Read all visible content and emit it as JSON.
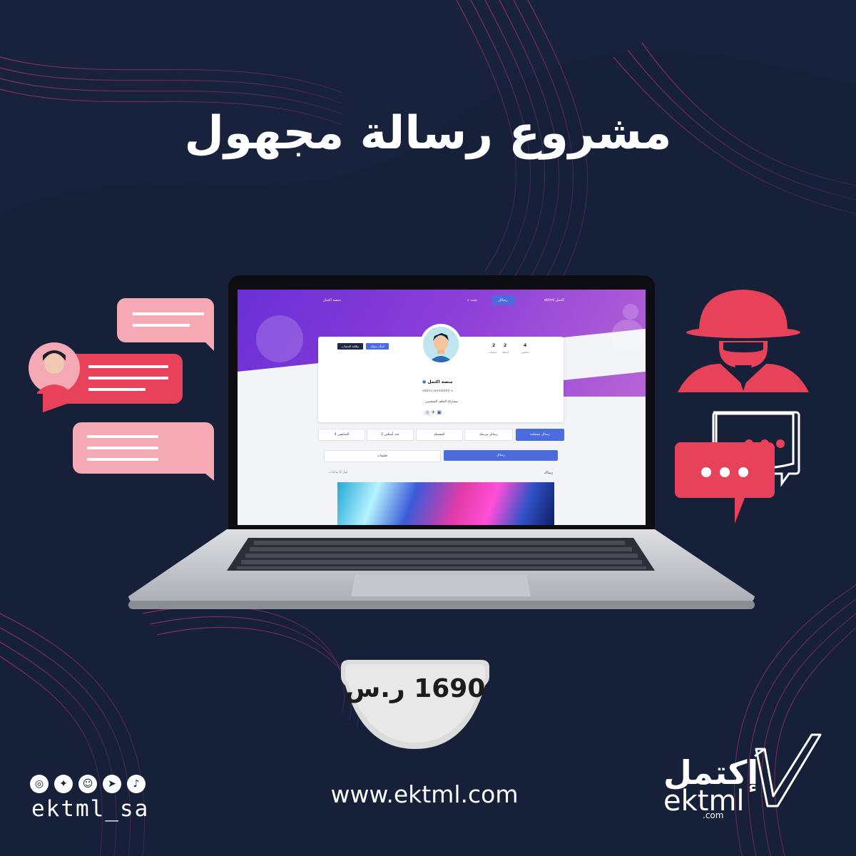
{
  "headline": "مشروع رسالة مجهول",
  "screen": {
    "nav": {
      "messages_button": "رسائل",
      "search": "بحث",
      "site_name": "منصة اكتمل",
      "logo_ar": "اكتمل",
      "logo_en": "ektml"
    },
    "profile": {
      "name": "منصة اكتمل",
      "link": "ektml.com/ektml",
      "share_label": "مشاركة الملف الشخصي",
      "stats": [
        {
          "value": "4",
          "label": "متابعين"
        },
        {
          "value": "2",
          "label": "أسئلة"
        },
        {
          "value": "2",
          "label": "متابعات"
        }
      ],
      "ask_button": "أسأل سؤال",
      "card_button": "بطاقة الحساب"
    },
    "tabs": [
      "رسائل مستلمة",
      "رسائل مرسلة",
      "المفضلة",
      "عدد أسئلتي 2",
      "المتابعين 4"
    ],
    "segments": [
      "رسائل",
      "تعليقات"
    ],
    "post": {
      "title": "رسالة",
      "time": "قبل 8 ساعات"
    }
  },
  "price": "1690 ر.س",
  "website": "www.ektml.com",
  "social": {
    "handle": "ektml_sa",
    "icons": [
      "instagram-icon",
      "twitter-icon",
      "snapchat-icon",
      "telegram-icon",
      "tiktok-icon"
    ]
  },
  "logo": {
    "ar": "إكتمل",
    "en": "ektml",
    "domain": ".com"
  },
  "colors": {
    "background": "#172039",
    "accent_red": "#e8425a",
    "accent_pink": "#f5a9b4",
    "screen_purple": "#7a38d8",
    "button_blue": "#4c6bde"
  }
}
